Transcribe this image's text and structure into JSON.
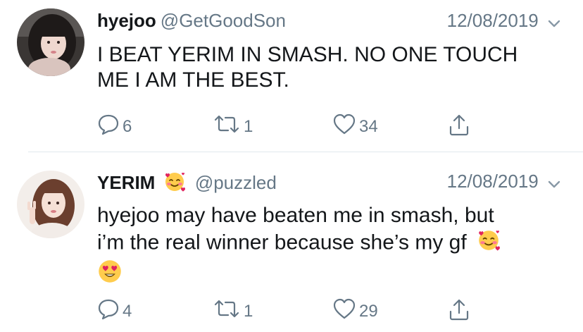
{
  "tweets": [
    {
      "display_name": "hyejoo",
      "handle": "@GetGoodSon",
      "date": "12/08/2019",
      "text_lines": [
        "I BEAT YERIM IN SMASH. NO ONE TOUCH",
        "ME I AM THE BEST."
      ],
      "reply_count": "6",
      "retweet_count": "1",
      "like_count": "34"
    },
    {
      "display_name": "YERIM",
      "name_emoji": "smiling-face-with-hearts",
      "handle": "@puzzled",
      "date": "12/08/2019",
      "text_lines": [
        "hyejoo may have beaten me in smash, but",
        "i’m the real winner because she’s my gf"
      ],
      "text_emojis": [
        "smiling-face-with-hearts",
        "heart-eyes"
      ],
      "reply_count": "4",
      "retweet_count": "1",
      "like_count": "29"
    }
  ],
  "colors": {
    "text": "#14171a",
    "secondary": "#657786",
    "divider": "#e1e8ed",
    "background": "#ffffff"
  }
}
